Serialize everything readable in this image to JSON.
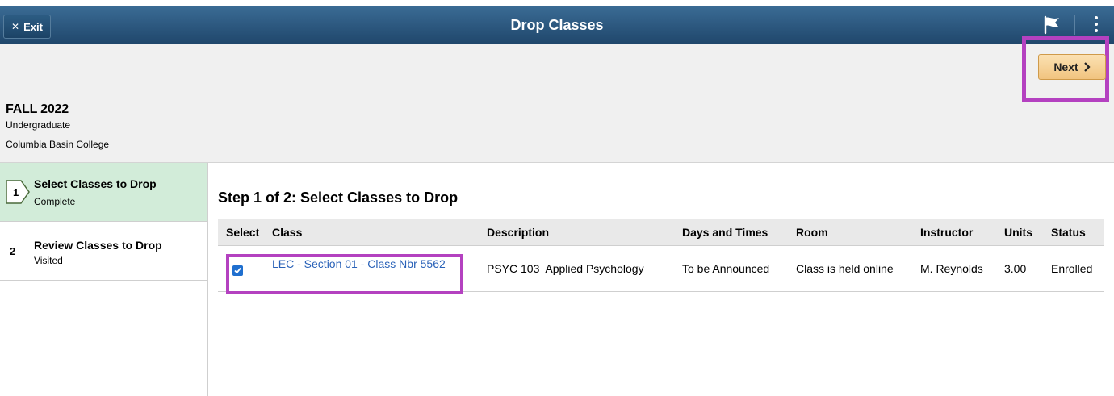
{
  "header": {
    "exit_label": "Exit",
    "title": "Drop Classes",
    "flag_icon": "flag-icon",
    "menu_icon": "more-vertical-icon"
  },
  "banner": {
    "term": "FALL 2022",
    "career": "Undergraduate",
    "institution": "Columbia Basin College",
    "next_label": "Next"
  },
  "steps": [
    {
      "number": "1",
      "title": "Select Classes to Drop",
      "status": "Complete"
    },
    {
      "number": "2",
      "title": "Review Classes to Drop",
      "status": "Visited"
    }
  ],
  "main": {
    "heading": "Step 1 of 2: Select Classes to Drop",
    "columns": [
      "Select",
      "Class",
      "Description",
      "Days and Times",
      "Room",
      "Instructor",
      "Units",
      "Status"
    ],
    "rows": [
      {
        "selected": true,
        "class": "LEC - Section 01 - Class Nbr 5562",
        "description": "PSYC 103  Applied Psychology",
        "days_times": "To be Announced",
        "room": "Class is held online",
        "instructor": "M. Reynolds",
        "units": "3.00",
        "status": "Enrolled"
      }
    ]
  },
  "colors": {
    "header": "#20476c",
    "active_step": "#d2ecd9",
    "highlight": "#b441c0",
    "link": "#2a62b8",
    "next_button": "#f1c47f"
  }
}
